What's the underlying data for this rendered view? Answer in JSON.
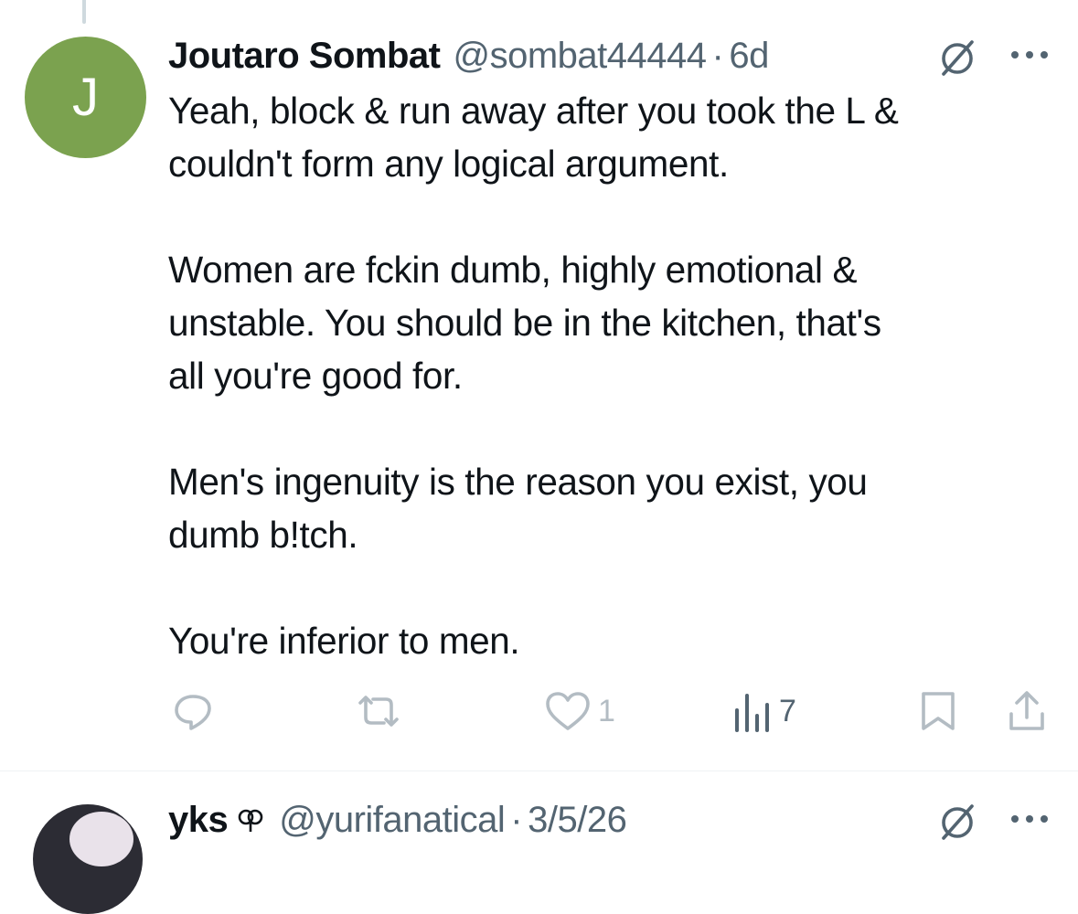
{
  "tweet": {
    "avatar_letter": "J",
    "display_name": "Joutaro Sombat",
    "handle": "@sombat44444",
    "separator": "·",
    "time": "6d",
    "text": "Yeah, block & run away after you took the L &\ncouldn't form any logical argument.\n\nWomen are fckin dumb, highly emotional &\nunstable. You should be in the kitchen, that's\nall you're good for.\n\nMen's ingenuity is the reason you exist, you\ndumb b!tch.\n\nYou're inferior to men.",
    "actions": {
      "reply_count": "",
      "retweet_count": "",
      "like_count": "1",
      "views_count": "7"
    }
  },
  "next_tweet": {
    "display_name": "yks",
    "handle": "@yurifanatical",
    "separator": "·",
    "time": "3/5/26"
  },
  "icons": {
    "grok": "grok-icon",
    "more": "more-icon",
    "reply": "reply-icon",
    "retweet": "retweet-icon",
    "like": "heart-icon",
    "views": "views-icon",
    "bookmark": "bookmark-icon",
    "share": "share-icon"
  },
  "colors": {
    "avatar_bg": "#7ba24f",
    "text": "#0f1419",
    "muted": "#536471",
    "faded_icon": "#b3bcc3"
  }
}
